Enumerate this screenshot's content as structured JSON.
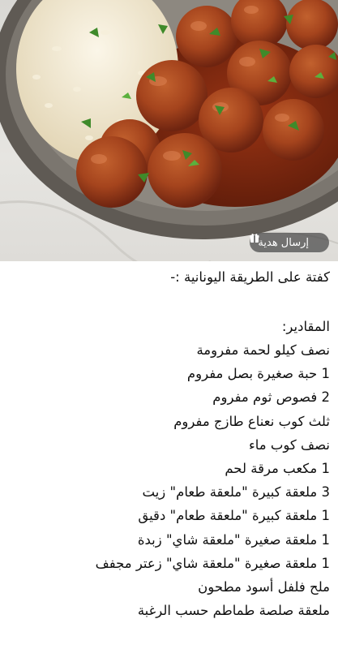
{
  "photo": {
    "alt_subject": "meatballs-with-rice-plate"
  },
  "gift_button": {
    "label": "إرسال هدية",
    "icon": "gift-icon"
  },
  "recipe": {
    "title": "كفتة على الطريقة اليونانية :-",
    "ingredients_heading": "المقادير:",
    "ingredients": [
      "نصف كيلو لحمة مفرومة",
      "1 حبة صغيرة بصل مفروم",
      "2 فصوص ثوم مفروم",
      "ثلث كوب نعناع طازج مفروم",
      "نصف كوب ماء",
      "1 مكعب مرقة لحم",
      "3 ملعقة كبيرة \"ملعقة طعام\" زيت",
      "1 ملعقة كبيرة \"ملعقة طعام\" دقيق",
      "1 ملعقة صغيرة \"ملعقة شاي\" زبدة",
      "1 ملعقة صغيرة \"ملعقة شاي\" زعتر مجفف",
      "ملح فلفل أسود مطحون",
      "ملعقة صلصة طماطم حسب الرغبة"
    ]
  },
  "colors": {
    "sauce": "#8a2a10",
    "meatball": "#a5441d",
    "rice": "#efe6cf",
    "plate": "#6f6a63",
    "herb": "#3f8a2a"
  }
}
